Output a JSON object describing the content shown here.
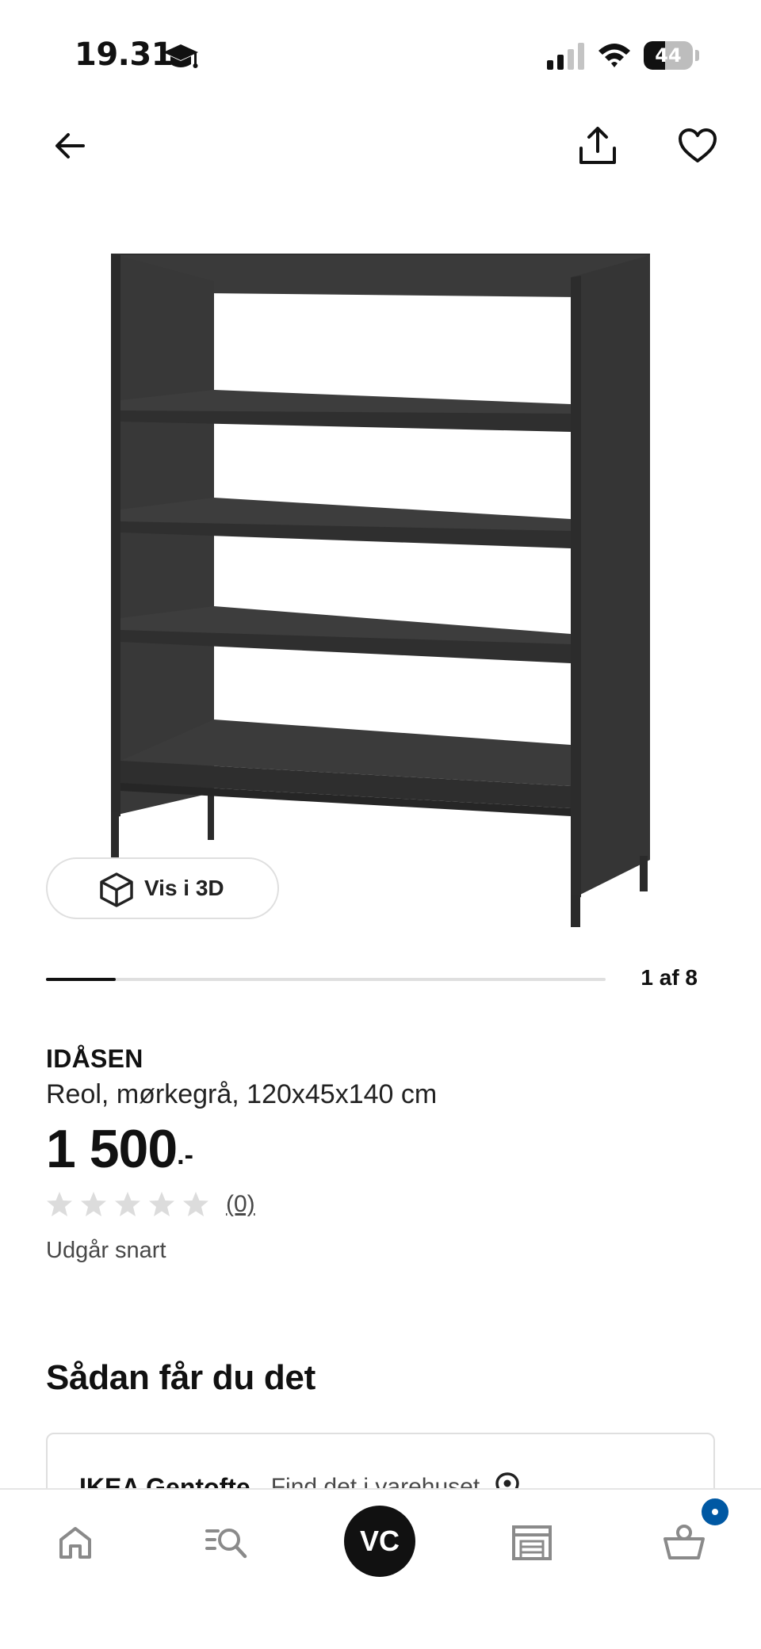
{
  "status_bar": {
    "time": "19.31",
    "battery_level": "44",
    "battery_fraction": 0.44
  },
  "top_nav": {
    "back_icon": "arrow-left-icon",
    "share_icon": "share-icon",
    "favorite_icon": "heart-icon"
  },
  "gallery": {
    "image_subject": "dark grey shelving unit",
    "view_3d_label": "Vis i 3D",
    "view_3d_icon": "cube-icon",
    "counter": "1 af 8",
    "progress_fraction": 0.125
  },
  "product": {
    "name": "IDÅSEN",
    "description": "Reol, mørkegrå, 120x45x140 cm",
    "price": "1 500",
    "price_suffix": ".-",
    "rating_stars": 0,
    "rating_max": 5,
    "review_count": "(0)",
    "availability": "Udgår snart"
  },
  "delivery": {
    "title": "Sådan får du det",
    "store_name": "IKEA Gentofte",
    "store_link": "Find det i varehuset",
    "store_icon": "location-pin-icon"
  },
  "tab_bar": {
    "home_icon": "home-icon",
    "search_icon": "search-list-icon",
    "account_initials": "VC",
    "store_icon": "store-icon",
    "cart_icon": "shopping-basket-icon"
  },
  "colors": {
    "text": "#111111",
    "muted": "#484848",
    "border": "#dfdfdf",
    "badge": "#0058a3",
    "shelf": "#3f3f3f"
  }
}
